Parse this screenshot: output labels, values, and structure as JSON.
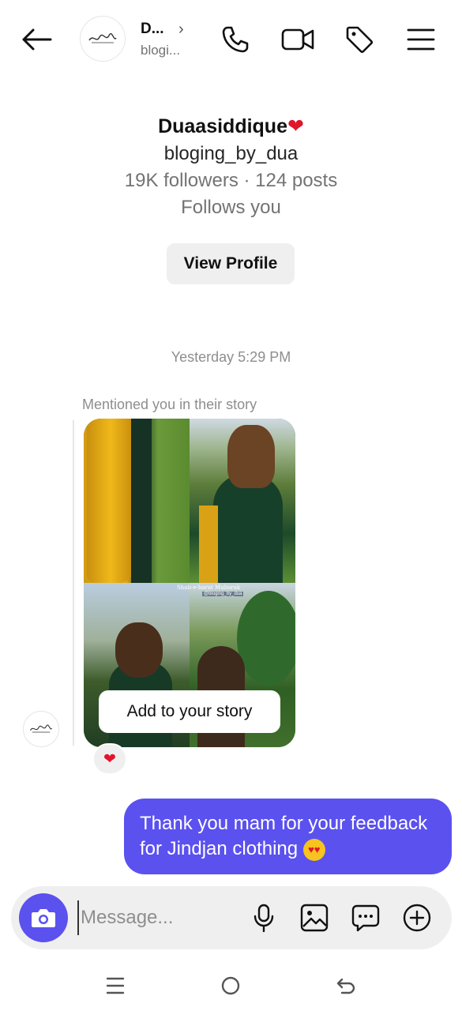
{
  "header": {
    "name_short": "D...",
    "username_short": "blogi...",
    "chevron": "›",
    "icons": [
      "back-arrow-icon",
      "phone-icon",
      "video-icon",
      "tag-icon",
      "menu-icon"
    ]
  },
  "profile": {
    "name": "Duaasiddique",
    "name_emoji": "❤",
    "username": "bloging_by_dua",
    "stats": "19K followers · 124 posts",
    "follows": "Follows you",
    "view_profile_label": "View Profile"
  },
  "conversation": {
    "timestamp": "Yesterday 5:29 PM",
    "mention_label": "Mentioned you in their story",
    "story": {
      "caption_1": "Shab-e-barat Mubarak",
      "caption_2": "@bloging_by_dua",
      "add_to_story_label": "Add to your story"
    },
    "reaction": "❤",
    "outgoing_message": "Thank you mam for your feedback for Jindjan clothing",
    "outgoing_emoji": "😍"
  },
  "composer": {
    "placeholder": "Message...",
    "icons": [
      "camera-icon",
      "microphone-icon",
      "gallery-icon",
      "chat-bubble-icon",
      "add-icon"
    ]
  },
  "navbar": {
    "icons": [
      "recent-apps-icon",
      "home-icon",
      "back-nav-icon"
    ]
  },
  "colors": {
    "accent": "#5b51ef",
    "heart": "#e0162b",
    "muted_text": "#8e8e8e",
    "chip_bg": "#efefef"
  }
}
